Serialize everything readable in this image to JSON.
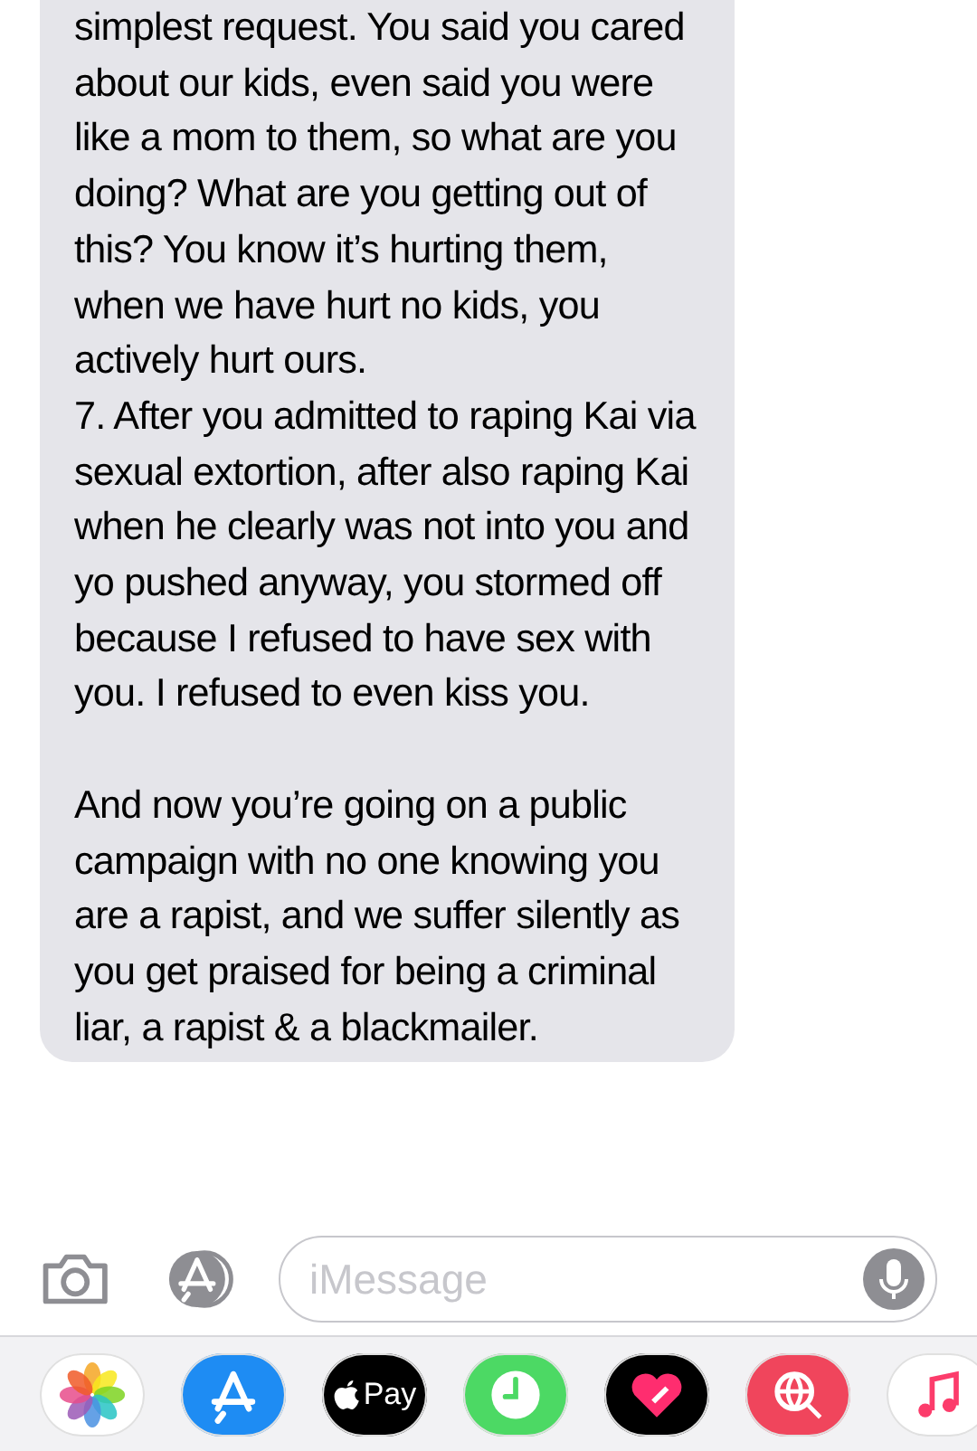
{
  "messages": [
    {
      "kind": "received",
      "paragraphs": [
        "simplest request. You said you cared about our kids, even said you were like a mom to them, so what are you doing? What are you getting out of this? You know it’s hurting them, when we have hurt no kids, you actively hurt ours.",
        "7. After you admitted to raping Kai via sexual extortion, after also raping Kai when he clearly was not into you and yo pushed anyway, you stormed off because I refused to have sex with you. I refused to even kiss you.",
        "And now you’re going on a public campaign with no one knowing you are a rapist, and we suffer silently as you get praised for being a criminal liar, a rapist & a blackmailer."
      ]
    }
  ],
  "compose": {
    "placeholder": "iMessage"
  },
  "dock": [
    {
      "kind": "photos"
    },
    {
      "kind": "appstore"
    },
    {
      "kind": "pay",
      "label": "Pay"
    },
    {
      "kind": "clock"
    },
    {
      "kind": "heart"
    },
    {
      "kind": "globe"
    },
    {
      "kind": "music"
    }
  ]
}
